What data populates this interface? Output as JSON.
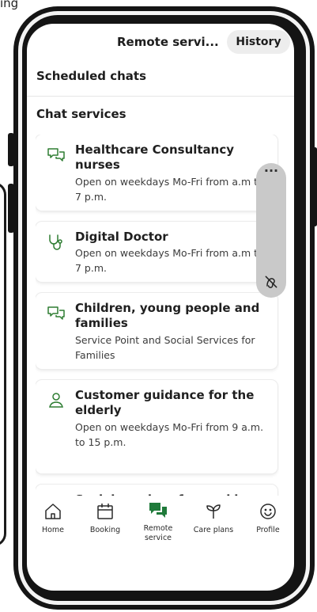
{
  "top_fragment": "ing",
  "header": {
    "title": "Remote servi...",
    "history_label": "History"
  },
  "sections": {
    "scheduled": "Scheduled chats",
    "chat_services": "Chat services"
  },
  "services": [
    {
      "icon": "chat-bubbles-icon",
      "title": "Healthcare Consultancy nurses",
      "description": "Open on weekdays Mo-Fri from a.m to 7 p.m."
    },
    {
      "icon": "stethoscope-icon",
      "title": "Digital Doctor",
      "description": "Open on weekdays Mo-Fri from a.m to 7 p.m."
    },
    {
      "icon": "chat-bubbles-icon",
      "title": "Children, young people and families",
      "description": "Service Point and Social Services for Families"
    },
    {
      "icon": "people-icon",
      "title": "Customer guidance for the elderly",
      "description": "Open on weekdays Mo-Fri from 9 a.m. to 15 p.m."
    },
    {
      "icon": "people-icon",
      "title": "Social services for working-age people",
      "description": ""
    }
  ],
  "floating_panel": {
    "menu_label": "···",
    "icon": "mute-icon"
  },
  "nav": [
    {
      "icon": "home-icon",
      "label": "Home"
    },
    {
      "icon": "calendar-icon",
      "label": "Booking"
    },
    {
      "icon": "chat-filled-icon",
      "label": "Remote service",
      "active": true
    },
    {
      "icon": "sprout-icon",
      "label": "Care plans"
    },
    {
      "icon": "smiley-icon",
      "label": "Profile"
    }
  ],
  "colors": {
    "accent": "#1f7a3a",
    "icon_stroke": "#2e7d32",
    "text": "#1d1d1d",
    "history_bg": "#ededed"
  }
}
